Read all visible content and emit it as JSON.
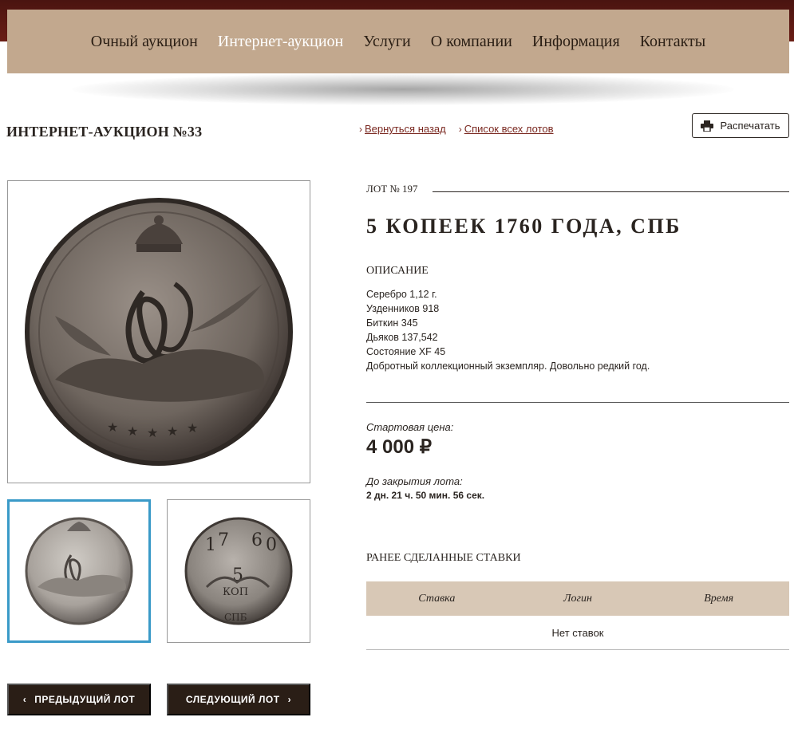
{
  "nav": {
    "items": [
      {
        "label": "Очный аукцион"
      },
      {
        "label": "Интернет-аукцион"
      },
      {
        "label": "Услуги"
      },
      {
        "label": "О компании"
      },
      {
        "label": "Информация"
      },
      {
        "label": "Контакты"
      }
    ],
    "active_index": 1
  },
  "page": {
    "auction_title": "ИНТЕРНЕТ-АУКЦИОН №33",
    "back_link": "Вернуться назад",
    "all_lots_link": "Список всех лотов",
    "print_label": "Распечатать"
  },
  "lot": {
    "number": "ЛОТ № 197",
    "title": "5 КОПЕЕК 1760 ГОДА, СПБ",
    "description_heading": "ОПИСАНИЕ",
    "description_lines": [
      "Серебро 1,12 г.",
      "Узденников 918",
      "Биткин 345",
      "Дьяков 137,542",
      "Состояние XF 45",
      "Добротный коллекционный экземпляр. Довольно редкий год."
    ],
    "start_price_label": "Стартовая цена:",
    "start_price": "4 000 ₽",
    "closing_label": "До закрытия лота:",
    "closing_time": "2 дн. 21 ч. 50 мин. 56 сек."
  },
  "bids": {
    "heading": "РАНЕЕ СДЕЛАННЫЕ СТАВКИ",
    "columns": [
      "Ставка",
      "Логин",
      "Время"
    ],
    "empty_text": "Нет ставок"
  },
  "lot_nav": {
    "prev_label": "ПРЕДЫДУЩИЙ ЛОТ",
    "next_label": "СЛЕДУЮЩИЙ ЛОТ"
  },
  "colors": {
    "topbar": "#5a1a14",
    "navbar": "#c2a88e",
    "accent_link": "#7a2820",
    "thumb_selected_border": "#3a9ac8",
    "dark_button": "#2a1e16",
    "table_header": "#d8c8b6"
  },
  "thumbs": {
    "selected_index": 0
  },
  "thumb2_engraving": {
    "year_digits": [
      "1",
      "7",
      "6",
      "0"
    ],
    "denomination": "5",
    "unit": "КОП",
    "mint": "СПБ"
  },
  "icons": {
    "print": "printer-icon",
    "back": "chevron-right-icon",
    "prev": "chevron-left-icon",
    "next": "chevron-right-icon"
  }
}
